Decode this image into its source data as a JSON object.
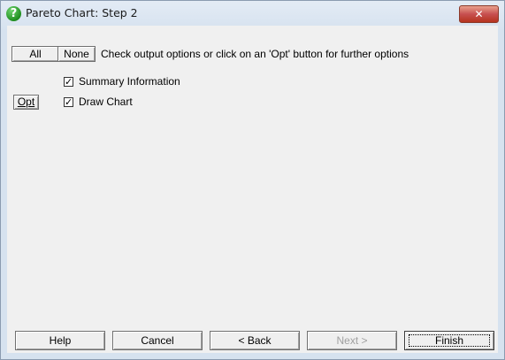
{
  "window": {
    "title": "Pareto Chart: Step 2",
    "icon": "help-question-icon",
    "close_glyph": "✕"
  },
  "toolbar": {
    "all_label": "All",
    "none_label": "None",
    "instruction": "Check output options or click on an 'Opt' button for further options"
  },
  "options": [
    {
      "label": "Summary Information",
      "checked": true,
      "has_opt": false
    },
    {
      "label": "Draw Chart",
      "checked": true,
      "has_opt": true,
      "opt_label": "Opt"
    }
  ],
  "footer": {
    "help_label": "Help",
    "cancel_label": "Cancel",
    "back_label": "< Back",
    "next_label": "Next >",
    "finish_label": "Finish"
  }
}
